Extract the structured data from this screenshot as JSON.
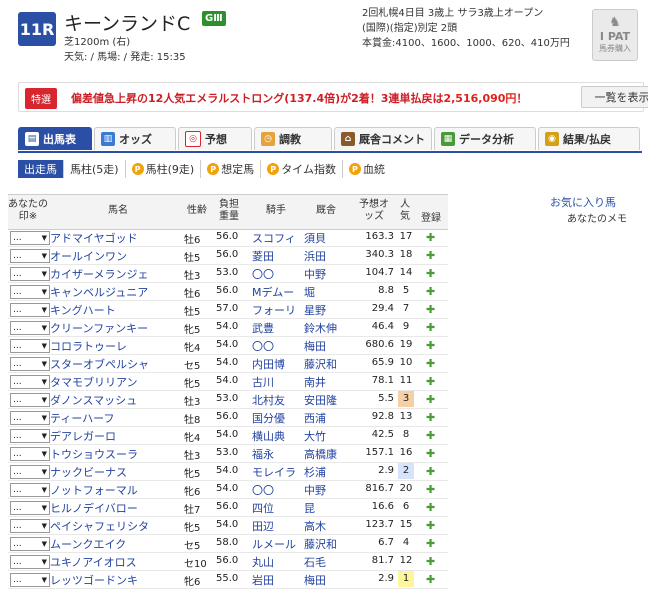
{
  "race": {
    "number": "11R",
    "name": "キーンランドC",
    "grade": "GⅢ",
    "course": "芝1200m (右)",
    "conditions": "天気: / 馬場: / 発走: 15:35",
    "meta_line1": "2回札幌4日目  3歳上  サラ3歳上オープン",
    "meta_line2": "(国際)(指定)別定  2頭",
    "meta_line3": "本賞金:4100、1600、1000、620、410万円"
  },
  "ipat": {
    "label1": "I PAT",
    "label2": "馬券購入"
  },
  "notice": {
    "badge": "特選",
    "text_before": "偏差値急上昇の12人気エメラルストロング(137.4倍)が2着！3連単払戻は",
    "amount": "2,516,090円",
    "text_after": "！",
    "button": "一覧を表示"
  },
  "tabs": [
    {
      "label": "出馬表",
      "icon": "list-icon"
    },
    {
      "label": "オッズ",
      "icon": "chart-icon"
    },
    {
      "label": "予想",
      "icon": "target-icon"
    },
    {
      "label": "調教",
      "icon": "clock-icon"
    },
    {
      "label": "厩舎コメント",
      "icon": "house-icon"
    },
    {
      "label": "データ分析",
      "icon": "data-icon"
    },
    {
      "label": "結果/払戻",
      "icon": "coins-icon"
    }
  ],
  "subtabs": [
    {
      "label": "出走馬",
      "premium": false
    },
    {
      "label": "馬柱(5走)",
      "premium": false
    },
    {
      "label": "馬柱(9走)",
      "premium": true
    },
    {
      "label": "想定馬",
      "premium": true
    },
    {
      "label": "タイム指数",
      "premium": true
    },
    {
      "label": "血統",
      "premium": true
    }
  ],
  "table": {
    "headers": {
      "mark": "あなたの印※",
      "horse": "馬名",
      "sexage": "性齢",
      "weight": "負担重量",
      "jockey": "騎手",
      "trainer": "厩舎",
      "odds": "予想オッズ",
      "pop": "人気",
      "reg": "登録"
    },
    "fav_label": "お気に入り馬",
    "memo_label": "あなたのメモ",
    "rows": [
      {
        "mark": "...",
        "name": "アドマイヤゴッド",
        "sex": "牡6",
        "wt": "56.0",
        "jockey": "スコフィ",
        "trainer": "須貝",
        "odds": "163.3",
        "pop": "17"
      },
      {
        "mark": "...",
        "name": "オールインワン",
        "sex": "牡5",
        "wt": "56.0",
        "jockey": "菱田",
        "trainer": "浜田",
        "odds": "340.3",
        "pop": "18"
      },
      {
        "mark": "...",
        "name": "カイザーメランジェ",
        "sex": "牡3",
        "wt": "53.0",
        "jockey": "〇〇",
        "trainer": "中野",
        "odds": "104.7",
        "pop": "14"
      },
      {
        "mark": "...",
        "name": "キャンベルジュニア",
        "sex": "牡6",
        "wt": "56.0",
        "jockey": "Mデムー",
        "trainer": "堀",
        "odds": "8.8",
        "pop": "5"
      },
      {
        "mark": "...",
        "name": "キングハート",
        "sex": "牡5",
        "wt": "57.0",
        "jockey": "フォーリ",
        "trainer": "星野",
        "odds": "29.4",
        "pop": "7"
      },
      {
        "mark": "...",
        "name": "クリーンファンキー",
        "sex": "牝5",
        "wt": "54.0",
        "jockey": "武豊",
        "trainer": "鈴木伸",
        "odds": "46.4",
        "pop": "9"
      },
      {
        "mark": "...",
        "name": "コロラトゥーレ",
        "sex": "牝4",
        "wt": "54.0",
        "jockey": "〇〇",
        "trainer": "梅田",
        "odds": "680.6",
        "pop": "19"
      },
      {
        "mark": "...",
        "name": "スターオブペルシャ",
        "sex": "セ5",
        "wt": "54.0",
        "jockey": "内田博",
        "trainer": "藤沢和",
        "odds": "65.9",
        "pop": "10"
      },
      {
        "mark": "...",
        "name": "タマモブリリアン",
        "sex": "牝5",
        "wt": "54.0",
        "jockey": "古川",
        "trainer": "南井",
        "odds": "78.1",
        "pop": "11"
      },
      {
        "mark": "...",
        "name": "ダノンスマッシュ",
        "sex": "牡3",
        "wt": "53.0",
        "jockey": "北村友",
        "trainer": "安田隆",
        "odds": "5.5",
        "pop": "3"
      },
      {
        "mark": "...",
        "name": "ティーハーフ",
        "sex": "牡8",
        "wt": "56.0",
        "jockey": "国分優",
        "trainer": "西浦",
        "odds": "92.8",
        "pop": "13"
      },
      {
        "mark": "...",
        "name": "デアレガーロ",
        "sex": "牝4",
        "wt": "54.0",
        "jockey": "横山典",
        "trainer": "大竹",
        "odds": "42.5",
        "pop": "8"
      },
      {
        "mark": "...",
        "name": "トウショウスーラ",
        "sex": "牡3",
        "wt": "53.0",
        "jockey": "福永",
        "trainer": "高橋康",
        "odds": "157.1",
        "pop": "16"
      },
      {
        "mark": "...",
        "name": "ナックビーナス",
        "sex": "牝5",
        "wt": "54.0",
        "jockey": "モレイラ",
        "trainer": "杉浦",
        "odds": "2.9",
        "pop": "2"
      },
      {
        "mark": "...",
        "name": "ノットフォーマル",
        "sex": "牝6",
        "wt": "54.0",
        "jockey": "〇〇",
        "trainer": "中野",
        "odds": "816.7",
        "pop": "20"
      },
      {
        "mark": "...",
        "name": "ヒルノデイバロー",
        "sex": "牡7",
        "wt": "56.0",
        "jockey": "四位",
        "trainer": "昆",
        "odds": "16.6",
        "pop": "6"
      },
      {
        "mark": "...",
        "name": "ペイシャフェリシタ",
        "sex": "牝5",
        "wt": "54.0",
        "jockey": "田辺",
        "trainer": "高木",
        "odds": "123.7",
        "pop": "15"
      },
      {
        "mark": "...",
        "name": "ムーンクエイク",
        "sex": "セ5",
        "wt": "58.0",
        "jockey": "ルメール",
        "trainer": "藤沢和",
        "odds": "6.7",
        "pop": "4"
      },
      {
        "mark": "...",
        "name": "ユキノアイオロス",
        "sex": "セ10",
        "wt": "56.0",
        "jockey": "丸山",
        "trainer": "石毛",
        "odds": "81.7",
        "pop": "12"
      },
      {
        "mark": "...",
        "name": "レッツゴードンキ",
        "sex": "牝6",
        "wt": "55.0",
        "jockey": "岩田",
        "trainer": "梅田",
        "odds": "2.9",
        "pop": "1"
      }
    ]
  },
  "colors": {
    "accent": "#2a4fa4",
    "pop1": "#fff59a",
    "pop2": "#d6e4fb",
    "pop3": "#f6cfa6",
    "grade": "#2f8f2f"
  }
}
